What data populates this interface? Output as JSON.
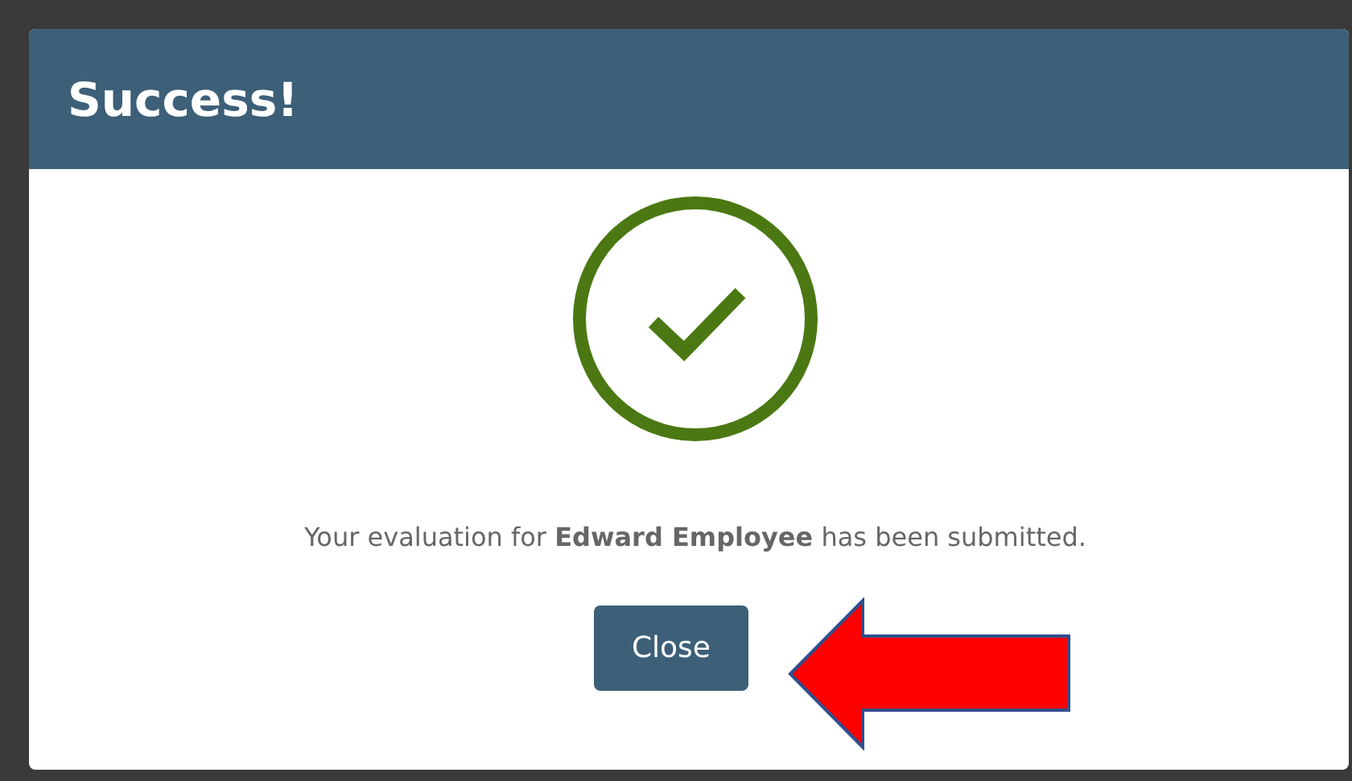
{
  "dialog": {
    "title": "Success!",
    "message": "Your evaluation for **Edward Employee** has been submitted.",
    "buttons": [
      "Close"
    ]
  }
}
